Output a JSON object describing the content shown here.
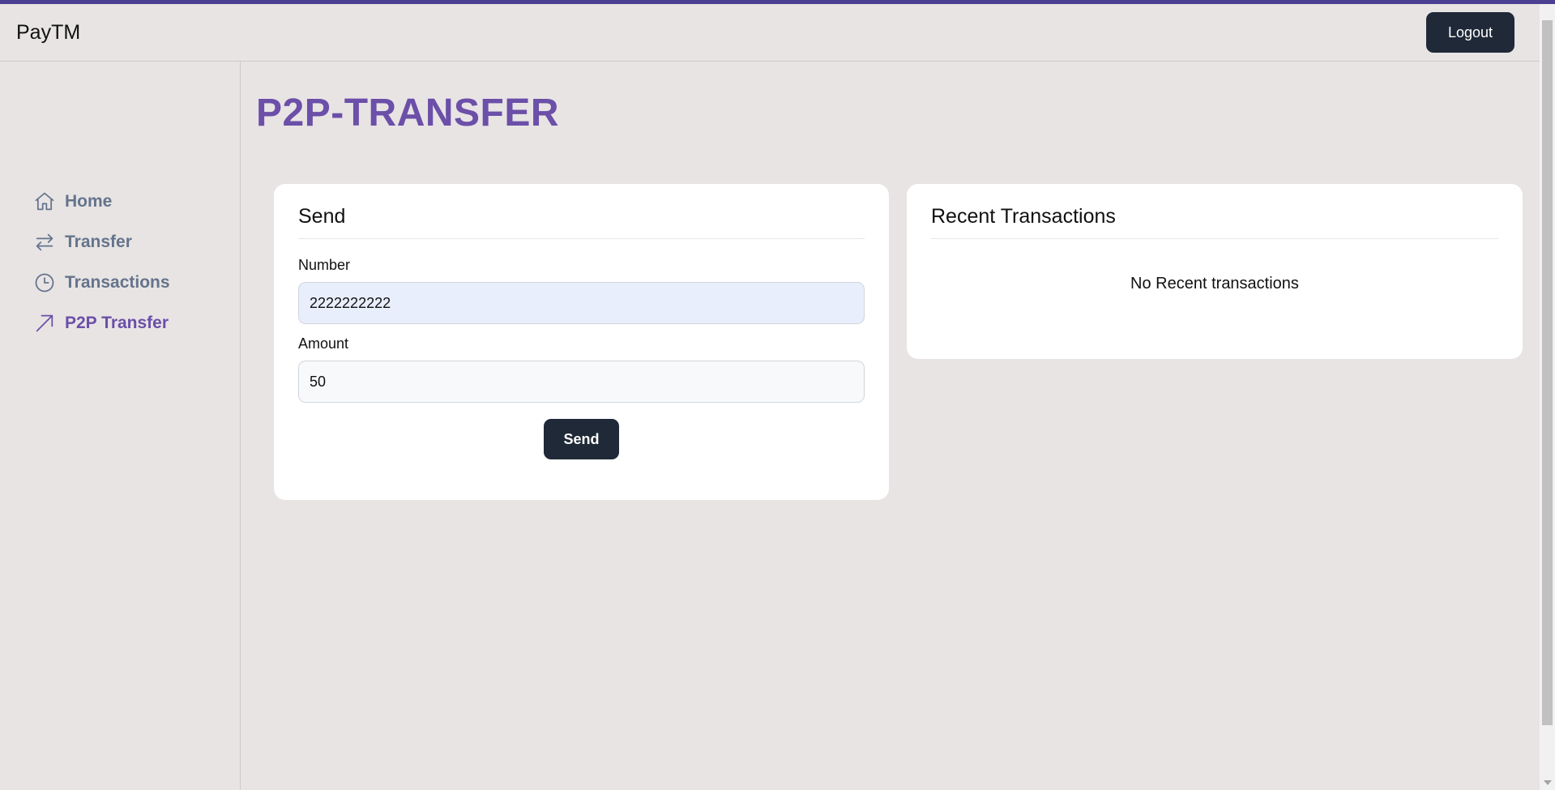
{
  "header": {
    "brand": "PayTM",
    "logout_label": "Logout"
  },
  "sidebar": {
    "items": [
      {
        "label": "Home",
        "icon": "home-icon",
        "active": false
      },
      {
        "label": "Transfer",
        "icon": "arrows-swap-icon",
        "active": false
      },
      {
        "label": "Transactions",
        "icon": "clock-icon",
        "active": false
      },
      {
        "label": "P2P Transfer",
        "icon": "arrow-up-right-icon",
        "active": true
      }
    ]
  },
  "main": {
    "title": "P2P-TRANSFER",
    "send_card": {
      "title": "Send",
      "number_label": "Number",
      "number_value": "2222222222",
      "amount_label": "Amount",
      "amount_value": "50",
      "send_label": "Send"
    },
    "recent_card": {
      "title": "Recent Transactions",
      "empty_message": "No Recent transactions"
    }
  },
  "colors": {
    "accent": "#6b4fa8",
    "button_dark": "#1f2937",
    "background": "#e8e4e4",
    "top_bar": "#4b3f91"
  }
}
